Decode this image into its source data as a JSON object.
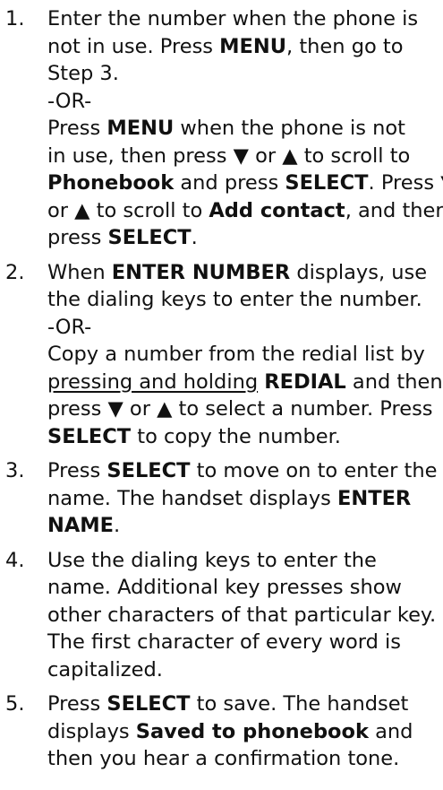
{
  "steps": [
    {
      "number": "1.",
      "lines": [
        [
          {
            "t": "Enter the number when the phone is"
          }
        ],
        [
          {
            "t": "not in use. Press "
          },
          {
            "t": "MENU",
            "b": true
          },
          {
            "t": ", then go to"
          }
        ],
        [
          {
            "t": "Step 3."
          }
        ],
        [
          {
            "t": "-OR-"
          }
        ],
        [
          {
            "t": "Press "
          },
          {
            "t": "MENU",
            "b": true
          },
          {
            "t": " when the phone is not"
          }
        ],
        [
          {
            "t": "in use, then press ▼ or ▲ to scroll to"
          }
        ],
        [
          {
            "t": "Phonebook",
            "b": true
          },
          {
            "t": " and press "
          },
          {
            "t": "SELECT",
            "b": true
          },
          {
            "t": ". Press ▼"
          }
        ],
        [
          {
            "t": "or ▲ to scroll to "
          },
          {
            "t": "Add contact",
            "b": true
          },
          {
            "t": ", and then"
          }
        ],
        [
          {
            "t": "press "
          },
          {
            "t": "SELECT",
            "b": true
          },
          {
            "t": "."
          }
        ]
      ]
    },
    {
      "number": "2.",
      "lines": [
        [
          {
            "t": "When "
          },
          {
            "t": "ENTER NUMBER",
            "b": true
          },
          {
            "t": " displays, use"
          }
        ],
        [
          {
            "t": "the dialing keys to enter the number."
          }
        ],
        [
          {
            "t": "-OR-"
          }
        ],
        [
          {
            "t": "Copy a number from the redial list by"
          }
        ],
        [
          {
            "t": "pressing and holding",
            "u": true
          },
          {
            "t": " "
          },
          {
            "t": "REDIAL",
            "b": true
          },
          {
            "t": " and then"
          }
        ],
        [
          {
            "t": "press ▼ or ▲ to select a number. Press"
          }
        ],
        [
          {
            "t": "SELECT",
            "b": true
          },
          {
            "t": " to copy the number."
          }
        ]
      ]
    },
    {
      "number": "3.",
      "lines": [
        [
          {
            "t": "Press "
          },
          {
            "t": "SELECT",
            "b": true
          },
          {
            "t": " to move on to enter the"
          }
        ],
        [
          {
            "t": "name. The handset displays "
          },
          {
            "t": "ENTER",
            "b": true
          }
        ],
        [
          {
            "t": "NAME",
            "b": true
          },
          {
            "t": "."
          }
        ]
      ]
    },
    {
      "number": "4.",
      "lines": [
        [
          {
            "t": "Use the dialing keys to enter the"
          }
        ],
        [
          {
            "t": "name. Additional key presses show"
          }
        ],
        [
          {
            "t": "other characters of that particular key."
          }
        ],
        [
          {
            "t": "The first character of every word is"
          }
        ],
        [
          {
            "t": "capitalized."
          }
        ]
      ]
    },
    {
      "number": "5.",
      "lines": [
        [
          {
            "t": "Press "
          },
          {
            "t": "SELECT",
            "b": true
          },
          {
            "t": " to save. The handset"
          }
        ],
        [
          {
            "t": "displays "
          },
          {
            "t": "Saved to phonebook",
            "b": true
          },
          {
            "t": " and"
          }
        ],
        [
          {
            "t": "then you hear a confirmation tone."
          }
        ]
      ]
    }
  ]
}
